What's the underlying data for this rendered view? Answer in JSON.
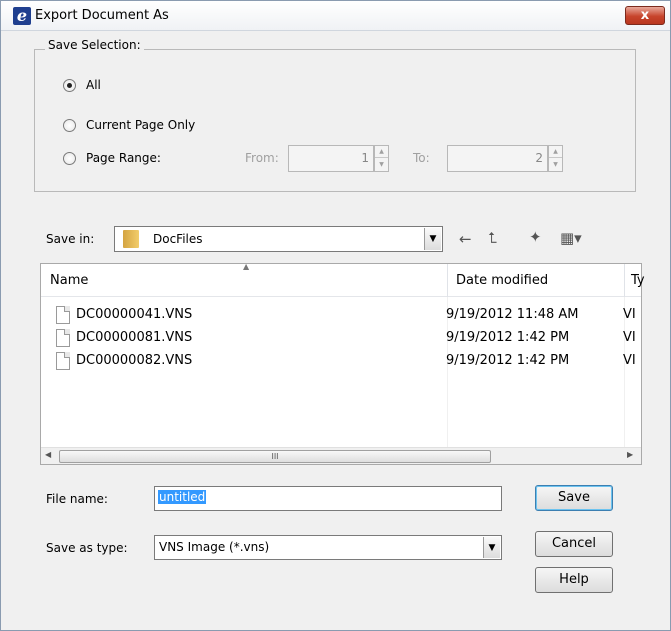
{
  "dialog": {
    "title": "Export Document As",
    "close_symbol": "x"
  },
  "save_selection": {
    "legend": "Save Selection:",
    "options": [
      {
        "label": "All",
        "checked": true
      },
      {
        "label": "Current Page Only",
        "checked": false
      },
      {
        "label": "Page Range:",
        "checked": false
      }
    ],
    "from_label": "From:",
    "from_value": "1",
    "to_label": "To:",
    "to_value": "2"
  },
  "save_in": {
    "label": "Save in:",
    "folder": "DocFiles"
  },
  "file_list": {
    "columns": [
      "Name",
      "Date modified",
      "Ty"
    ],
    "files": [
      {
        "name": "DC00000041.VNS",
        "date": "9/19/2012 11:48 AM",
        "type": "VI"
      },
      {
        "name": "DC00000081.VNS",
        "date": "9/19/2012 1:42 PM",
        "type": "VI"
      },
      {
        "name": "DC00000082.VNS",
        "date": "9/19/2012 1:42 PM",
        "type": "VI"
      }
    ],
    "scroll_thumb_grip": "III"
  },
  "file_name": {
    "label": "File name:",
    "value": "untitled"
  },
  "save_as_type": {
    "label": "Save as type:",
    "value": "VNS Image (*.vns)"
  },
  "buttons": {
    "save": "Save",
    "cancel": "Cancel",
    "help": "Help"
  },
  "colors": {
    "selection": "#3399ff",
    "close": "#c7442c"
  }
}
